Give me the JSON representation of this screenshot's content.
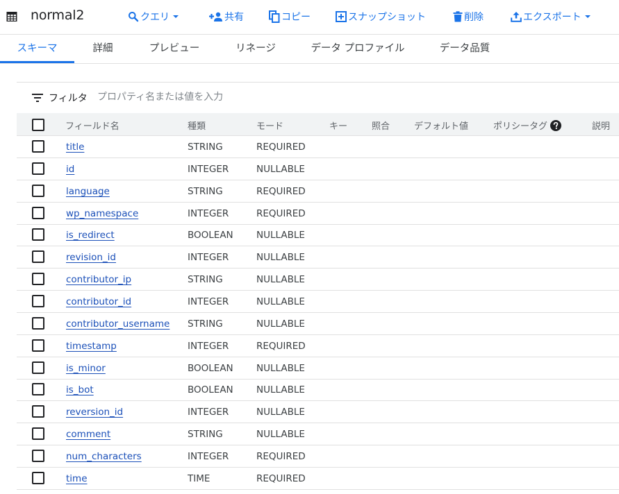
{
  "header": {
    "title": "normal2",
    "toolbar": [
      {
        "id": "query",
        "label": "クエリ",
        "icon": "search-icon",
        "dropdown": true
      },
      {
        "id": "share",
        "label": "共有",
        "icon": "person-add-icon",
        "dropdown": false
      },
      {
        "id": "copy",
        "label": "コピー",
        "icon": "copy-icon",
        "dropdown": false
      },
      {
        "id": "snapshot",
        "label": "スナップショット",
        "icon": "add-box-icon",
        "dropdown": false
      },
      {
        "id": "delete",
        "label": "削除",
        "icon": "trash-icon",
        "dropdown": false
      },
      {
        "id": "export",
        "label": "エクスポート",
        "icon": "upload-icon",
        "dropdown": true
      }
    ]
  },
  "tabs": [
    {
      "label": "スキーマ",
      "active": true
    },
    {
      "label": "詳細",
      "active": false
    },
    {
      "label": "プレビュー",
      "active": false
    },
    {
      "label": "リネージ",
      "active": false
    },
    {
      "label": "データ プロファイル",
      "active": false
    },
    {
      "label": "データ品質",
      "active": false
    }
  ],
  "filter": {
    "label": "フィルタ",
    "placeholder": "プロパティ名または値を入力"
  },
  "table": {
    "columns": {
      "field_name": "フィールド名",
      "type": "種類",
      "mode": "モード",
      "key": "キー",
      "collation": "照合",
      "default_value": "デフォルト値",
      "policy_tags": "ポリシータグ",
      "description": "説明"
    },
    "rows": [
      {
        "name": "title",
        "type": "STRING",
        "mode": "REQUIRED"
      },
      {
        "name": "id",
        "type": "INTEGER",
        "mode": "NULLABLE"
      },
      {
        "name": "language",
        "type": "STRING",
        "mode": "REQUIRED"
      },
      {
        "name": "wp_namespace",
        "type": "INTEGER",
        "mode": "REQUIRED"
      },
      {
        "name": "is_redirect",
        "type": "BOOLEAN",
        "mode": "NULLABLE"
      },
      {
        "name": "revision_id",
        "type": "INTEGER",
        "mode": "NULLABLE"
      },
      {
        "name": "contributor_ip",
        "type": "STRING",
        "mode": "NULLABLE"
      },
      {
        "name": "contributor_id",
        "type": "INTEGER",
        "mode": "NULLABLE"
      },
      {
        "name": "contributor_username",
        "type": "STRING",
        "mode": "NULLABLE"
      },
      {
        "name": "timestamp",
        "type": "INTEGER",
        "mode": "REQUIRED"
      },
      {
        "name": "is_minor",
        "type": "BOOLEAN",
        "mode": "NULLABLE"
      },
      {
        "name": "is_bot",
        "type": "BOOLEAN",
        "mode": "NULLABLE"
      },
      {
        "name": "reversion_id",
        "type": "INTEGER",
        "mode": "NULLABLE"
      },
      {
        "name": "comment",
        "type": "STRING",
        "mode": "NULLABLE"
      },
      {
        "name": "num_characters",
        "type": "INTEGER",
        "mode": "REQUIRED"
      },
      {
        "name": "time",
        "type": "TIME",
        "mode": "REQUIRED"
      }
    ]
  },
  "colors": {
    "accent": "#1a73e8",
    "link": "#1a4fb8",
    "header_bg": "#f1f3f4",
    "divider": "#e0e0e0"
  }
}
